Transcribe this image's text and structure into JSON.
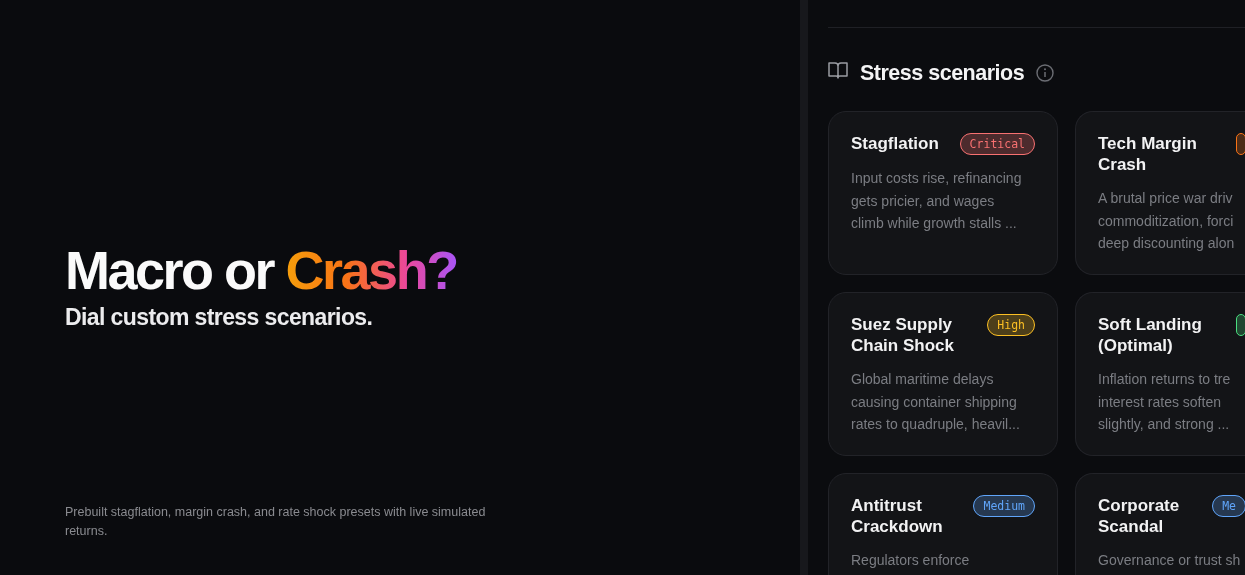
{
  "hero": {
    "title": "Macro or",
    "title_accent": "Crash?",
    "subtitle": "Dial custom stress scenarios.",
    "footnote": "Prebuilt stagflation, margin crash, and rate shock presets with live simulated returns."
  },
  "section": {
    "title": "Stress scenarios"
  },
  "scenarios": [
    {
      "title": "Stagflation",
      "color": "#f87171",
      "badge": "Critical",
      "lines": [
        "Input costs rise, refinancing",
        "gets pricier, and wages",
        "climb while growth stalls ..."
      ]
    },
    {
      "title": "Tech Margin Crash",
      "color": "#f97316",
      "lines": [
        "A brutal price war driv",
        "commoditization, forci",
        "deep discounting alon"
      ]
    },
    {
      "title": "Suez Supply Chain Shock",
      "color": "#fbbf24",
      "badge": "High",
      "lines": [
        "Global maritime delays",
        "causing container shipping",
        "rates to quadruple, heavil..."
      ]
    },
    {
      "title": "Soft Landing (Optimal)",
      "color": "#4ade80",
      "lines": [
        "Inflation returns to tre",
        "interest rates soften",
        "slightly, and strong ..."
      ]
    },
    {
      "title": "Antitrust Crackdown",
      "color": "#60a5fa",
      "badge": "Medium",
      "lines": [
        "Regulators enforce"
      ]
    },
    {
      "title": "Corporate Scandal",
      "color": "#60a5fa",
      "badge": "Me",
      "lines": [
        "Governance or trust sh"
      ]
    }
  ]
}
